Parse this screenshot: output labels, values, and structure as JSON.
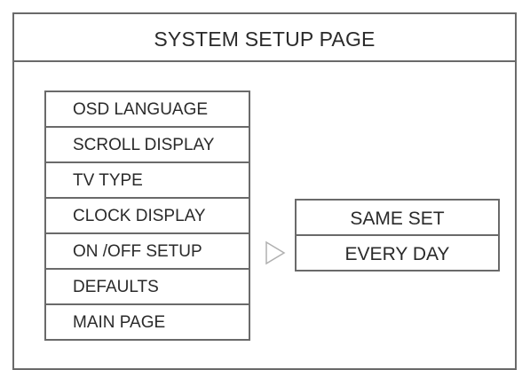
{
  "page": {
    "title": "SYSTEM SETUP PAGE"
  },
  "menu": {
    "items": [
      {
        "label": "OSD LANGUAGE"
      },
      {
        "label": "SCROLL DISPLAY"
      },
      {
        "label": "TV TYPE"
      },
      {
        "label": "CLOCK DISPLAY"
      },
      {
        "label": "ON /OFF SETUP"
      },
      {
        "label": "DEFAULTS"
      },
      {
        "label": "MAIN PAGE"
      }
    ]
  },
  "submenu": {
    "items": [
      {
        "label": "SAME SET"
      },
      {
        "label": "EVERY DAY"
      }
    ]
  },
  "icons": {
    "pointer": "right-triangle-outline-icon"
  },
  "colors": {
    "border": "#6a6a6a",
    "arrow": "#b0b0b0",
    "text": "#2a2a2a",
    "background": "#ffffff"
  }
}
